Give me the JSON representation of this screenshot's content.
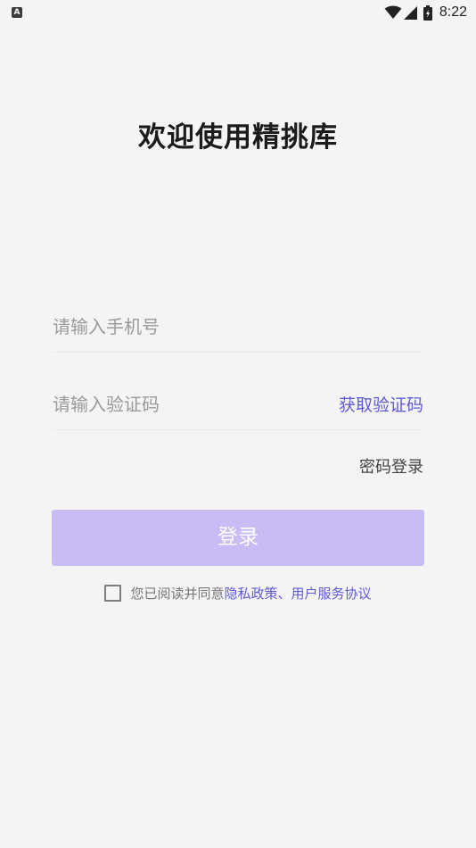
{
  "status_bar": {
    "notification_letter": "A",
    "time": "8:22",
    "icons": [
      "wifi-icon",
      "signal-icon",
      "battery-icon"
    ]
  },
  "title": "欢迎使用精挑库",
  "phone": {
    "placeholder": "请输入手机号",
    "value": ""
  },
  "code": {
    "placeholder": "请输入验证码",
    "value": "",
    "get_code_label": "获取验证码"
  },
  "password_login_label": "密码登录",
  "login_button_label": "登录",
  "agreement": {
    "checked": false,
    "prefix": "您已阅读并同意",
    "privacy_link": "隐私政策",
    "separator": "、",
    "service_link": "用户服务协议"
  },
  "colors": {
    "background": "#f4f4f4",
    "accent": "#5e5bd6",
    "button_disabled": "#c9bbf4"
  }
}
